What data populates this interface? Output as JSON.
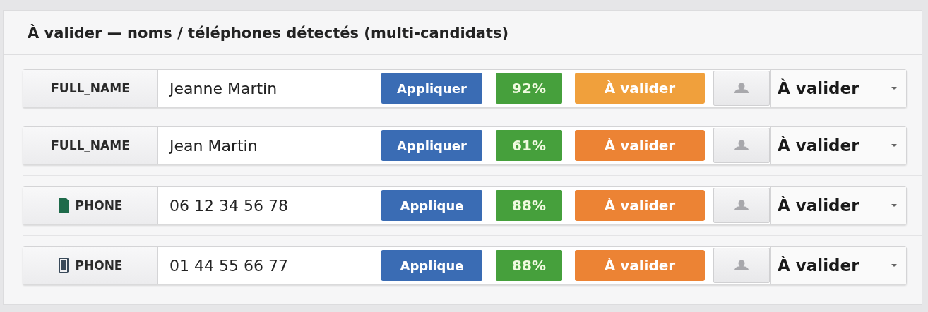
{
  "panel": {
    "title": "À valider — noms / téléphones détectés (multi-candidats)"
  },
  "candidates": [
    {
      "kind": "name",
      "type": "FULL_NAME",
      "value": "Jeanne Martin",
      "apply": "Appliquer",
      "confidence": "92%",
      "status": "À valider",
      "color": "#f0a03c",
      "choice": "À valider"
    },
    {
      "kind": "name",
      "type": "FULL_NAME",
      "value": "Jean Martin",
      "apply": "Appliquer",
      "confidence": "61%",
      "status": "À valider",
      "color": "#ec8334",
      "choice": "À valider"
    },
    {
      "kind": "mobile",
      "type": "PHONE",
      "value": "06 12 34 56 78",
      "apply": "Applique",
      "confidence": "88%",
      "status": "À valider",
      "color": "#ec8334",
      "choice": "À valider"
    },
    {
      "kind": "landline",
      "type": "PHONE",
      "value": "01 44 55 66 77",
      "apply": "Applique",
      "confidence": "88%",
      "status": "À valider",
      "color": "#ec8334",
      "choice": "À valider"
    }
  ]
}
